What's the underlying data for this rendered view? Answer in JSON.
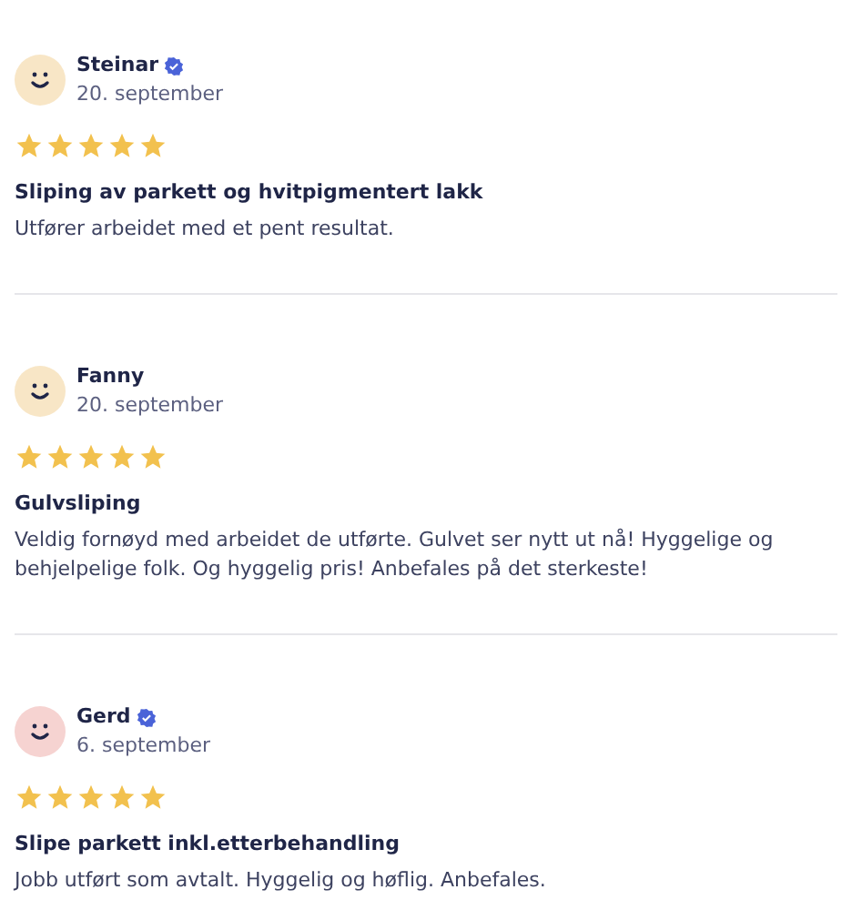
{
  "reviews": [
    {
      "name": "Steinar",
      "verified": true,
      "color": "#f8e6c6",
      "date": "20. september",
      "stars": 5,
      "title": "Sliping av parkett og hvitpigmentert lakk",
      "text": "Utfører arbeidet med et pent resultat."
    },
    {
      "name": "Fanny",
      "verified": false,
      "color": "#f8e6c6",
      "date": "20. september",
      "stars": 5,
      "title": "Gulvsliping",
      "text": "Veldig fornøyd med arbeidet de utførte. Gulvet ser nytt ut nå! Hyggelige og behjelpelige folk. Og hyggelig pris! Anbefales på det sterkeste!"
    },
    {
      "name": "Gerd",
      "verified": true,
      "color": "#f6d3d1",
      "date": "6. september",
      "stars": 5,
      "title": "Slipe parkett inkl.etterbehandling",
      "text": "Jobb utført som avtalt. Hyggelig og høflig. Anbefales."
    }
  ]
}
